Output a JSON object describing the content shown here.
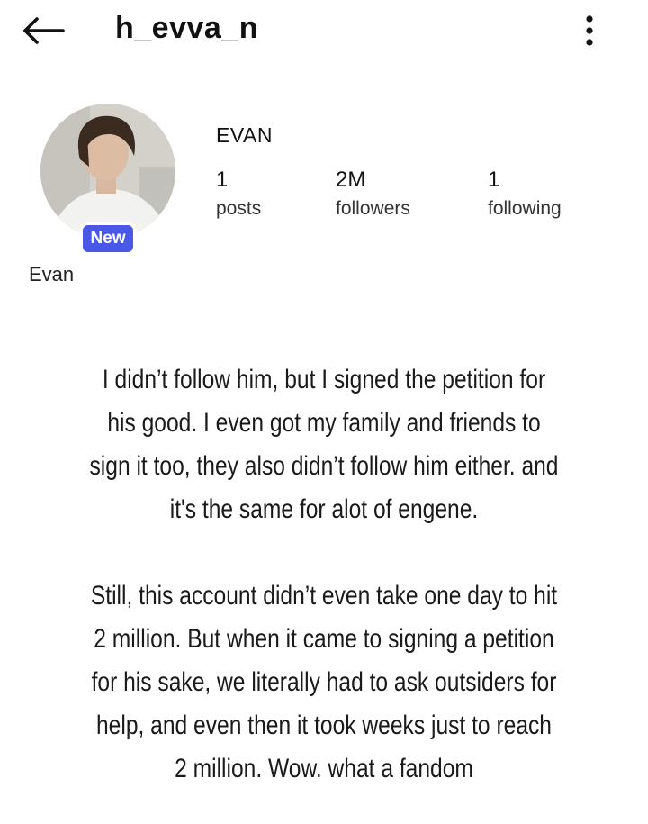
{
  "header": {
    "username": "h_evva_n",
    "back_icon": "arrow-left-icon",
    "more_icon": "vertical-dots-icon"
  },
  "profile": {
    "display_name": "EVAN",
    "avatar_caption": "Evan",
    "new_badge": "New",
    "badge_color": "#4a58e8",
    "stats": {
      "posts": {
        "value": "1",
        "label": "posts"
      },
      "followers": {
        "value": "2M",
        "label": "followers"
      },
      "following": {
        "value": "1",
        "label": "following"
      }
    }
  },
  "caption": {
    "paragraph_1": "I didn’t follow him, but I signed the petition for his good. I even got my family and friends to sign it too, they also didn’t follow him either. and it's the same for alot of engene.",
    "paragraph_2": "Still, this account didn’t even take one day to hit 2 million. But when it came to signing a petition for his sake, we literally had to ask outsiders for help, and even then it took weeks just to reach 2 million. Wow. what a fandom"
  }
}
